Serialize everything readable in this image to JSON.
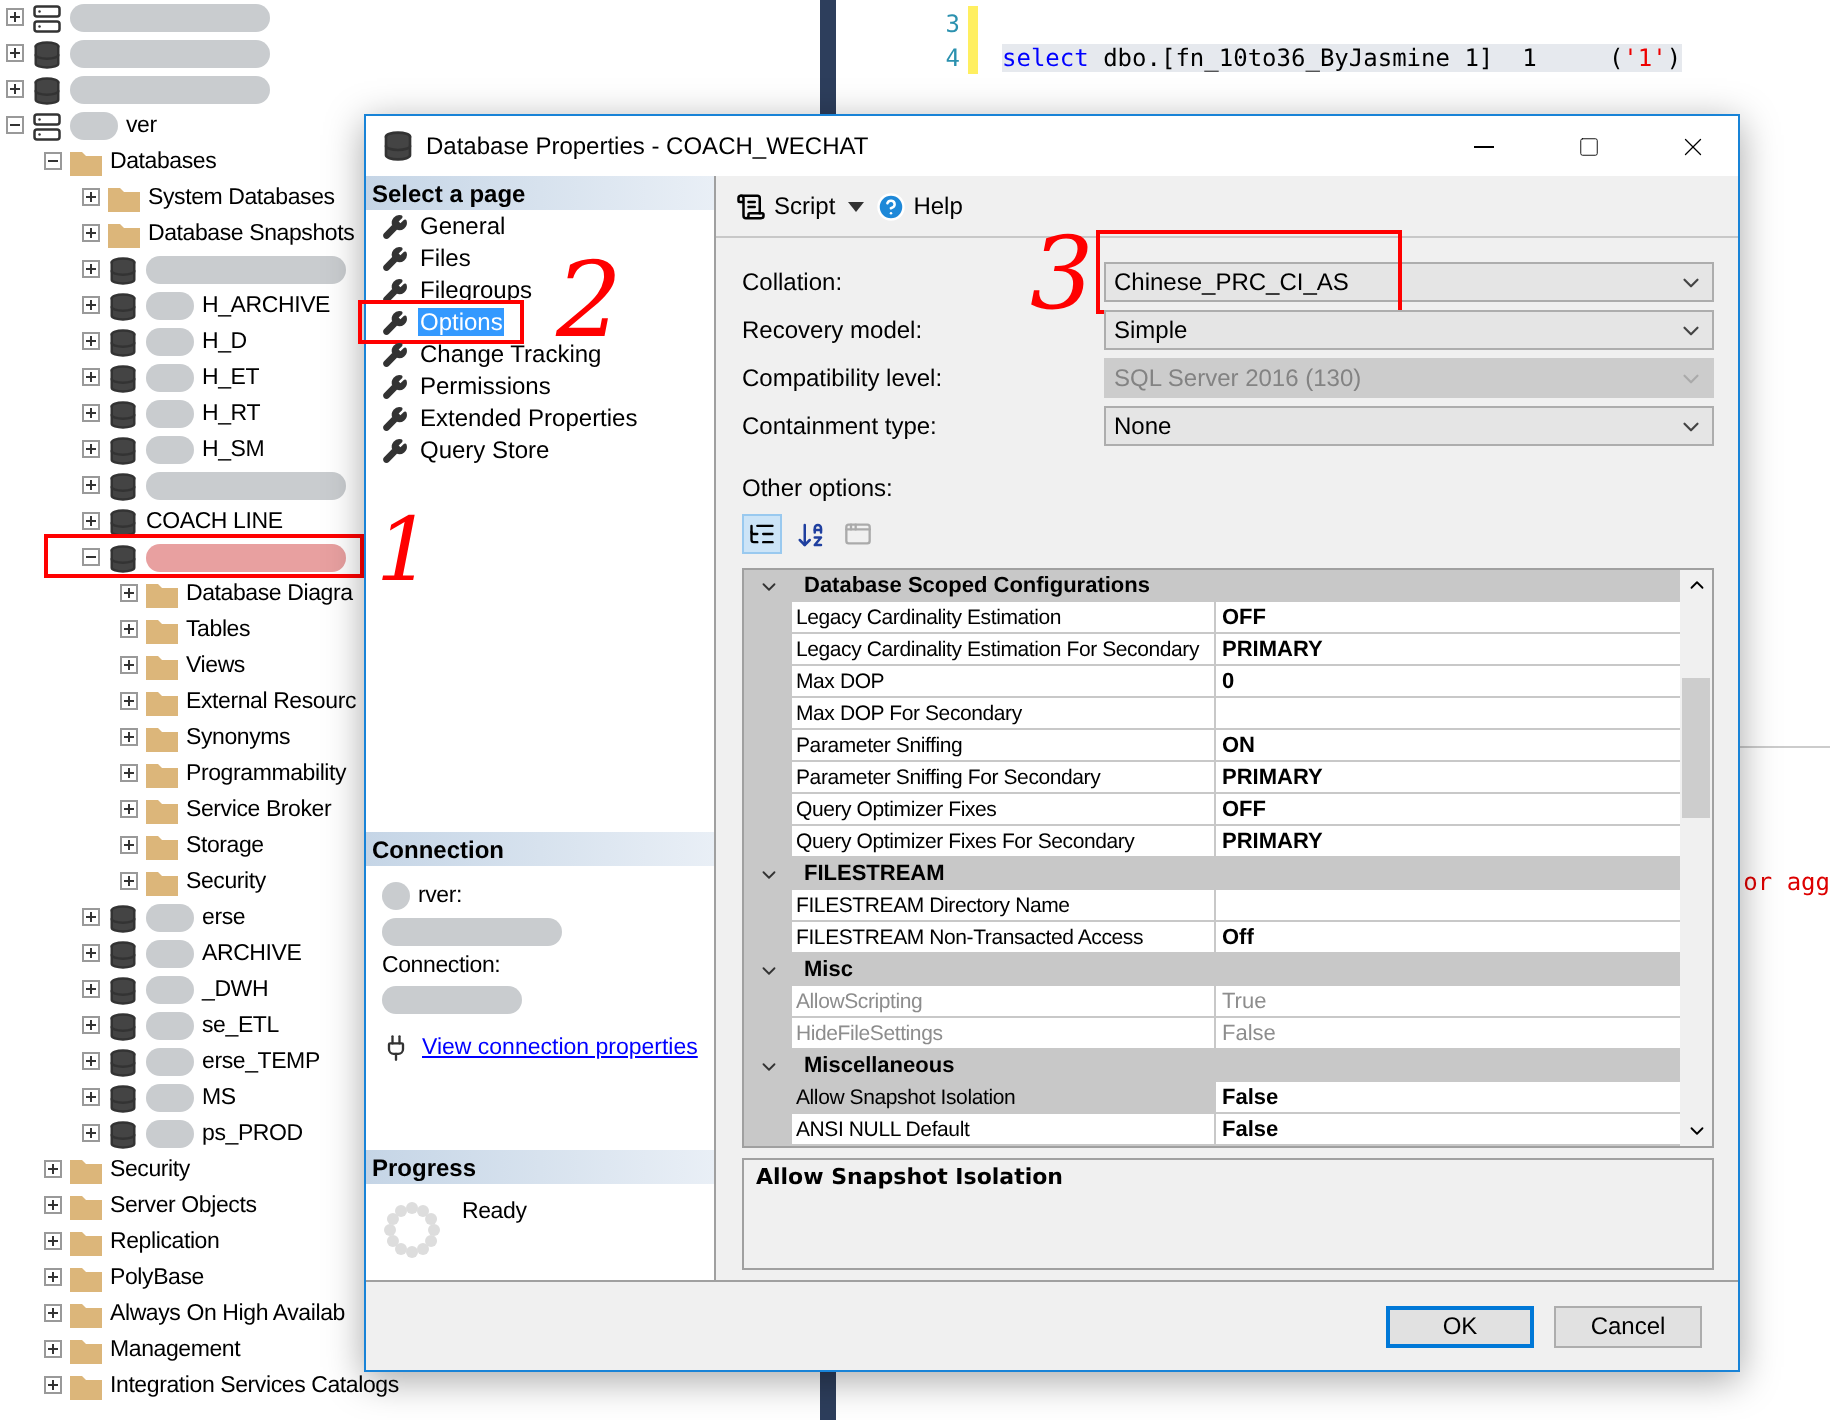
{
  "explorer": {
    "items": [
      {
        "kind": "server",
        "blurred": true,
        "expanded": false
      },
      {
        "kind": "database",
        "blurred": true,
        "expanded": false
      },
      {
        "kind": "database",
        "blurred": true,
        "expanded": false
      },
      {
        "kind": "server",
        "blurred": true,
        "label": "ver",
        "expanded": true,
        "children": [
          {
            "kind": "folder",
            "label": "Databases",
            "expanded": true,
            "children": [
              {
                "kind": "folder",
                "label": "System Databases",
                "expanded": false
              },
              {
                "kind": "folder",
                "label": "Database Snapshots",
                "expanded": false
              },
              {
                "kind": "database",
                "blurred": true,
                "expanded": false
              },
              {
                "kind": "database",
                "blurred": true,
                "label": "H_ARCHIVE",
                "expanded": false
              },
              {
                "kind": "database",
                "blurred": true,
                "label": "H_D",
                "expanded": false
              },
              {
                "kind": "database",
                "blurred": true,
                "label": "H_ET",
                "expanded": false
              },
              {
                "kind": "database",
                "blurred": true,
                "label": "H_RT",
                "expanded": false
              },
              {
                "kind": "database",
                "blurred": true,
                "label": "H_SM",
                "expanded": false
              },
              {
                "kind": "database",
                "blurred": true,
                "expanded": false
              },
              {
                "kind": "database",
                "label": "COACH LINE",
                "expanded": false
              },
              {
                "kind": "database",
                "blurred": true,
                "circled": true,
                "expanded": true,
                "children": [
                  {
                    "kind": "folder",
                    "label": "Database Diagra",
                    "expanded": false
                  },
                  {
                    "kind": "folder",
                    "label": "Tables",
                    "expanded": false
                  },
                  {
                    "kind": "folder",
                    "label": "Views",
                    "expanded": false
                  },
                  {
                    "kind": "folder",
                    "label": "External Resourc",
                    "expanded": false
                  },
                  {
                    "kind": "folder",
                    "label": "Synonyms",
                    "expanded": false
                  },
                  {
                    "kind": "folder",
                    "label": "Programmability",
                    "expanded": false
                  },
                  {
                    "kind": "folder",
                    "label": "Service Broker",
                    "expanded": false
                  },
                  {
                    "kind": "folder",
                    "label": "Storage",
                    "expanded": false
                  },
                  {
                    "kind": "folder",
                    "label": "Security",
                    "expanded": false
                  }
                ]
              },
              {
                "kind": "database",
                "blurred": true,
                "label": "erse",
                "expanded": false
              },
              {
                "kind": "database",
                "blurred": true,
                "label": "ARCHIVE",
                "expanded": false
              },
              {
                "kind": "database",
                "blurred": true,
                "label": "_DWH",
                "expanded": false
              },
              {
                "kind": "database",
                "blurred": true,
                "label": "se_ETL",
                "expanded": false
              },
              {
                "kind": "database",
                "blurred": true,
                "label": "erse_TEMP",
                "expanded": false
              },
              {
                "kind": "database",
                "blurred": true,
                "label": "MS",
                "expanded": false
              },
              {
                "kind": "database",
                "blurred": true,
                "label": "ps_PROD",
                "expanded": false
              }
            ]
          },
          {
            "kind": "folder",
            "label": "Security",
            "expanded": false
          },
          {
            "kind": "folder",
            "label": "Server Objects",
            "expanded": false
          },
          {
            "kind": "folder",
            "label": "Replication",
            "expanded": false
          },
          {
            "kind": "folder",
            "label": "PolyBase",
            "expanded": false
          },
          {
            "kind": "folder",
            "label": "Always On High Availab",
            "expanded": false
          },
          {
            "kind": "folder",
            "label": "Management",
            "expanded": false
          },
          {
            "kind": "folder",
            "label": "Integration Services Catalogs",
            "expanded": false
          }
        ]
      }
    ]
  },
  "editor": {
    "lines": [
      {
        "number": "3"
      },
      {
        "number": "4",
        "tokens": [
          {
            "kind": "keyword",
            "text": "select"
          },
          {
            "kind": "plain",
            "text": " dbo.[fn_10to36_ByJasmine 1]  1     ("
          },
          {
            "kind": "string",
            "text": "'1'"
          },
          {
            "kind": "plain",
            "text": ")"
          }
        ]
      }
    ]
  },
  "results": {
    "text": "or agg"
  },
  "dialog": {
    "title": "Database Properties - COACH_WECHAT",
    "select_page": {
      "heading": "Select a page",
      "items": [
        {
          "label": "General",
          "selected": false,
          "circled": false
        },
        {
          "label": "Files",
          "selected": false,
          "circled": false
        },
        {
          "label": "Filegroups",
          "selected": false,
          "circled": false
        },
        {
          "label": "Options",
          "selected": true,
          "circled": true
        },
        {
          "label": "Change Tracking",
          "selected": false,
          "circled": false
        },
        {
          "label": "Permissions",
          "selected": false,
          "circled": false
        },
        {
          "label": "Extended Properties",
          "selected": false,
          "circled": false
        },
        {
          "label": "Query Store",
          "selected": false,
          "circled": false
        }
      ]
    },
    "connection": {
      "heading": "Connection",
      "server_label": "rver:",
      "connection_label": "Connection:",
      "link": "View connection properties"
    },
    "progress": {
      "heading": "Progress",
      "status": "Ready"
    },
    "toolbar": {
      "script": "Script",
      "help": "Help"
    },
    "fields": [
      {
        "label": "Collation:",
        "value": "Chinese_PRC_CI_AS",
        "disabled": false,
        "circled": true
      },
      {
        "label": "Recovery model:",
        "value": "Simple",
        "disabled": false
      },
      {
        "label": "Compatibility level:",
        "value": "SQL Server 2016 (130)",
        "disabled": true
      },
      {
        "label": "Containment type:",
        "value": "None",
        "disabled": false
      }
    ],
    "other_options": "Other options:",
    "grid": {
      "categories": [
        {
          "name": "Database Scoped Configurations",
          "rows": [
            {
              "name": "Legacy Cardinality Estimation",
              "value": "OFF",
              "disabled": false,
              "selected": false
            },
            {
              "name": "Legacy Cardinality Estimation For Secondary",
              "value": "PRIMARY",
              "disabled": false,
              "selected": false
            },
            {
              "name": "Max DOP",
              "value": "0",
              "disabled": false,
              "selected": false
            },
            {
              "name": "Max DOP For Secondary",
              "disabled": false,
              "selected": false
            },
            {
              "name": "Parameter Sniffing",
              "value": "ON",
              "disabled": false,
              "selected": false
            },
            {
              "name": "Parameter Sniffing For Secondary",
              "value": "PRIMARY",
              "disabled": false,
              "selected": false
            },
            {
              "name": "Query Optimizer Fixes",
              "value": "OFF",
              "disabled": false,
              "selected": false
            },
            {
              "name": "Query Optimizer Fixes For Secondary",
              "value": "PRIMARY",
              "disabled": false,
              "selected": false
            }
          ]
        },
        {
          "name": "FILESTREAM",
          "rows": [
            {
              "name": "FILESTREAM Directory Name",
              "disabled": false,
              "selected": false
            },
            {
              "name": "FILESTREAM Non-Transacted Access",
              "value": "Off",
              "disabled": false,
              "selected": false
            }
          ]
        },
        {
          "name": "Misc",
          "rows": [
            {
              "name": "AllowScripting",
              "value": "True",
              "disabled": true,
              "selected": false
            },
            {
              "name": "HideFileSettings",
              "value": "False",
              "disabled": true,
              "selected": false
            }
          ]
        },
        {
          "name": "Miscellaneous",
          "rows": [
            {
              "name": "Allow Snapshot Isolation",
              "value": "False",
              "disabled": false,
              "selected": true
            },
            {
              "name": "ANSI NULL Default",
              "value": "False",
              "disabled": false,
              "selected": false
            }
          ]
        }
      ]
    },
    "description": "Allow Snapshot Isolation",
    "buttons": [
      {
        "label": "OK",
        "default": true
      },
      {
        "label": "Cancel",
        "default": false
      }
    ]
  },
  "annotations": [
    {
      "label": "3"
    },
    {
      "label": "2"
    },
    {
      "label": "1"
    }
  ]
}
